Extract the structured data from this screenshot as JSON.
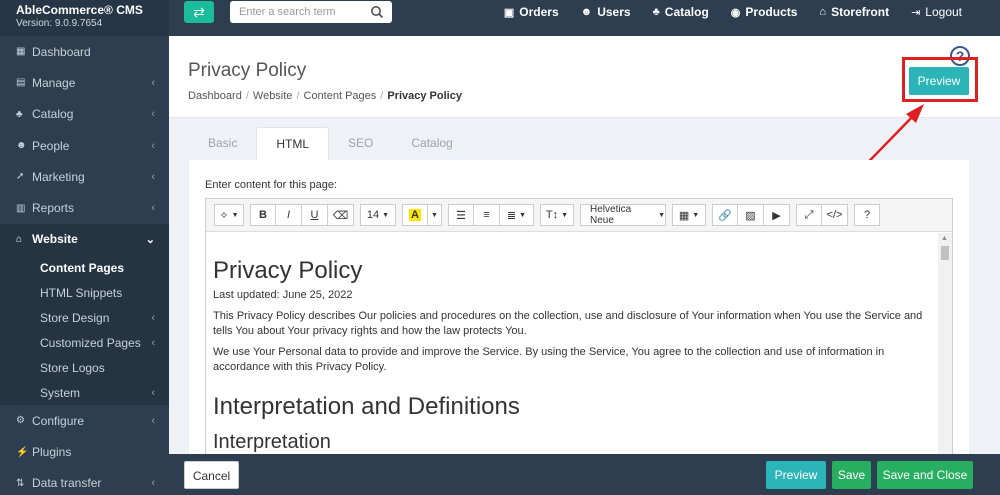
{
  "app": {
    "title": "AbleCommerce® CMS",
    "version": "Version: 9.0.9.7654"
  },
  "sidebar": {
    "items": [
      {
        "label": "Dashboard",
        "icon": "dashboard-icon",
        "glyph": "▦",
        "chev": ""
      },
      {
        "label": "Manage",
        "icon": "list-icon",
        "glyph": "▤",
        "chev": "‹"
      },
      {
        "label": "Catalog",
        "icon": "sitemap-icon",
        "glyph": "♣",
        "chev": "‹"
      },
      {
        "label": "People",
        "icon": "users-icon",
        "glyph": "☻",
        "chev": "‹"
      },
      {
        "label": "Marketing",
        "icon": "rocket-icon",
        "glyph": "➚",
        "chev": "‹"
      },
      {
        "label": "Reports",
        "icon": "bar-chart-icon",
        "glyph": "▥",
        "chev": "‹"
      },
      {
        "label": "Website",
        "icon": "home-icon",
        "glyph": "⌂",
        "chev": "⌄"
      }
    ],
    "website_sub": [
      {
        "label": "Content Pages",
        "chev": ""
      },
      {
        "label": "HTML Snippets",
        "chev": ""
      },
      {
        "label": "Store Design",
        "chev": "‹"
      },
      {
        "label": "Customized Pages",
        "chev": "‹"
      },
      {
        "label": "Store Logos",
        "chev": ""
      },
      {
        "label": "System",
        "chev": "‹"
      }
    ],
    "bottom": [
      {
        "label": "Configure",
        "icon": "cogs-icon",
        "glyph": "⚙",
        "chev": "‹"
      },
      {
        "label": "Plugins",
        "icon": "plug-icon",
        "glyph": "⚡",
        "chev": ""
      },
      {
        "label": "Data transfer",
        "icon": "transfer-icon",
        "glyph": "⇅",
        "chev": "‹"
      }
    ]
  },
  "topbar": {
    "toggle_glyph": "⇄",
    "search_placeholder": "Enter a search term",
    "links": [
      {
        "label": "Orders",
        "icon": "orders-icon",
        "glyph": "▣"
      },
      {
        "label": "Users",
        "icon": "users-icon",
        "glyph": "☻"
      },
      {
        "label": "Catalog",
        "icon": "sitemap-icon",
        "glyph": "♣"
      },
      {
        "label": "Products",
        "icon": "products-icon",
        "glyph": "◉"
      },
      {
        "label": "Storefront",
        "icon": "home-icon",
        "glyph": "⌂"
      },
      {
        "label": "Logout",
        "icon": "logout-icon",
        "glyph": "⇥"
      }
    ]
  },
  "header": {
    "title": "Privacy Policy",
    "breadcrumbs": [
      "Dashboard",
      "Website",
      "Content Pages",
      "Privacy Policy"
    ],
    "help_glyph": "?",
    "preview_label": "Preview"
  },
  "tabs": [
    "Basic",
    "HTML",
    "SEO",
    "Catalog"
  ],
  "editor": {
    "label": "Enter content for this page:",
    "font_size": "14",
    "font_name": "Helvetica Neue",
    "heading_glyph": "T↕",
    "code_glyph": "</>",
    "help_glyph": "?",
    "doc": {
      "h1": "Privacy Policy",
      "updated": "Last updated: June 25, 2022",
      "p1": "This Privacy Policy describes Our policies and procedures on the collection, use and disclosure of Your information when You use the Service and tells You about Your privacy rights and how the law protects You.",
      "p2": "We use Your Personal data to provide and improve the Service. By using the Service, You agree to the collection and use of information in accordance with this Privacy Policy.",
      "h2": "Interpretation and Definitions",
      "h3": "Interpretation"
    }
  },
  "footer": {
    "cancel": "Cancel",
    "preview": "Preview",
    "save": "Save",
    "save_close": "Save and Close"
  },
  "colors": {
    "sidebar": "#2c3e50",
    "accent_teal": "#2bb5b8",
    "save_green": "#27ae60",
    "toggle_green": "#1abc9c",
    "highlight_red": "#e02020"
  }
}
